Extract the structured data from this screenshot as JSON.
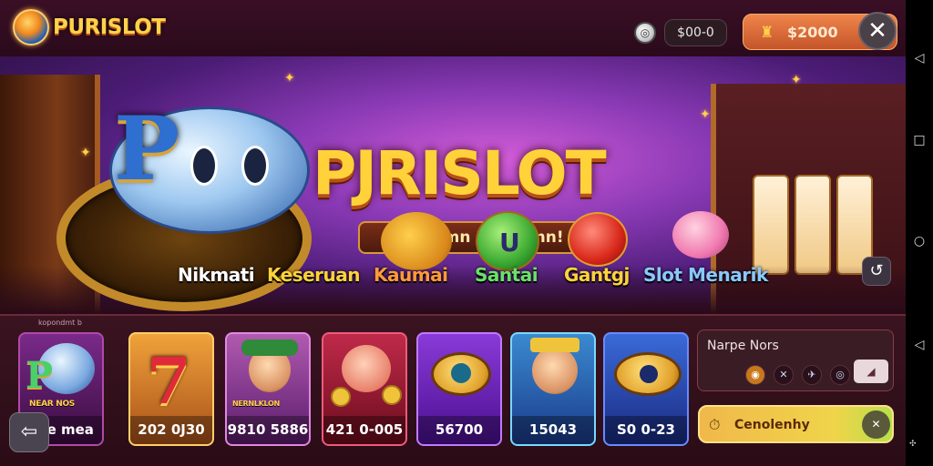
{
  "topbar": {
    "logo_text": "PURISLOT",
    "balance_small": "$00-0",
    "wallet_amount": "$2000",
    "close_glyph": "✕",
    "coin_glyph": "◎",
    "wallet_glyph": "♜"
  },
  "banner": {
    "title": "PJRISLOT",
    "tagline": "Gane Imn Mesiarnn!",
    "green_char_letter": "U",
    "features": [
      "Nikmati",
      "Keseruan",
      "Kaumai",
      "Santai",
      "Gantgj",
      "Slot Menarik"
    ],
    "refresh_glyph": "↺"
  },
  "tray": {
    "caption": "kopondmt b",
    "cards": [
      {
        "value": "1ae mea",
        "art_label": "NEAR NOS"
      },
      {
        "value": "202 0J30",
        "art_label": "7"
      },
      {
        "value": "9810 5886",
        "art_label": "NERNLKLON"
      },
      {
        "value": "421 0-005",
        "art_label": ""
      },
      {
        "value": "56700",
        "art_label": ""
      },
      {
        "value": "15043",
        "art_label": ""
      },
      {
        "value": "S0 0-23",
        "art_label": ""
      }
    ],
    "name_panel": {
      "title": "Narpe Nors",
      "icons": [
        "◉",
        "✕",
        "✈",
        "◎"
      ],
      "toggle_glyph": "◢"
    },
    "action": {
      "label": "Cenolenhy",
      "icon_glyph": "⏱",
      "round_glyph": "✕"
    },
    "back_glyph": "⇦"
  },
  "navbar": {
    "glyphs": [
      "◁",
      "□",
      "○",
      "◁"
    ],
    "tiny": "✣"
  },
  "colors": {
    "brand_gold": "#ffd23a",
    "wallet_orange": "#e0743c",
    "action_yellow": "#f0d44a"
  }
}
